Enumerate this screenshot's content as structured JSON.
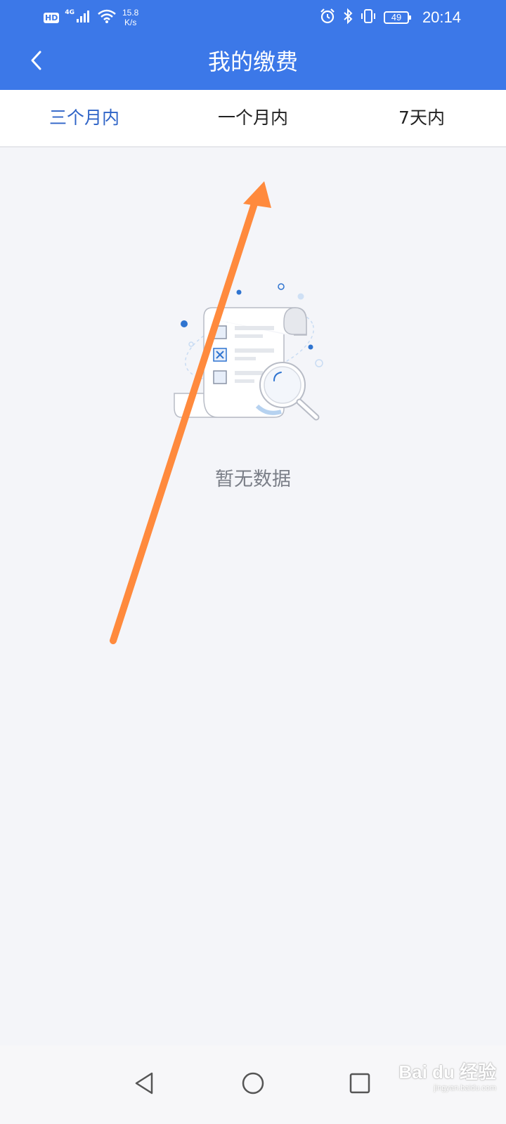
{
  "status_bar": {
    "hd": "HD",
    "network": "4G",
    "speed_value": "15.8",
    "speed_unit": "K/s",
    "battery": "49",
    "time": "20:14"
  },
  "header": {
    "title": "我的缴费",
    "back_icon": "chevron-left-icon"
  },
  "tabs": [
    {
      "label": "三个月内",
      "active": true
    },
    {
      "label": "一个月内",
      "active": false
    },
    {
      "label": "7天内",
      "active": false
    }
  ],
  "empty_state": {
    "message": "暂无数据",
    "icon": "empty-document-search-icon"
  },
  "nav_bar": {
    "back_icon": "triangle-back-icon",
    "home_icon": "circle-home-icon",
    "recents_icon": "square-recents-icon"
  },
  "watermark": {
    "main": "Bai du 经验",
    "sub": "jingyan.baidu.com"
  },
  "colors": {
    "primary": "#3c78e8",
    "active_tab": "#2f64c7",
    "background": "#f4f5f9",
    "arrow": "#ff8a3d"
  }
}
